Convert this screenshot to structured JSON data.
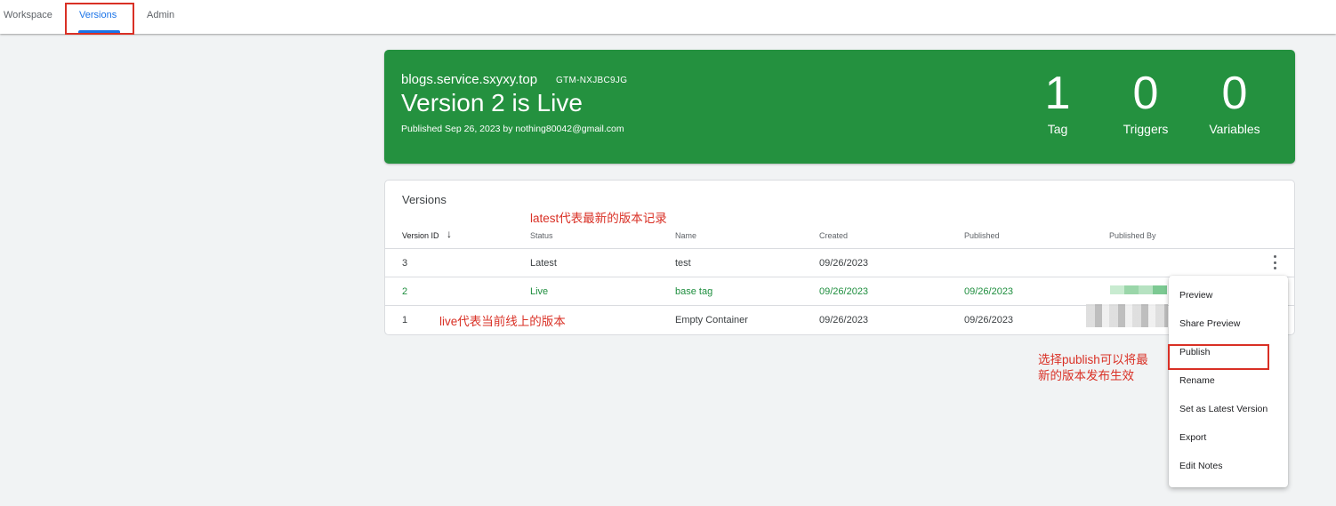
{
  "nav": {
    "tabs": [
      "Workspace",
      "Versions",
      "Admin"
    ],
    "active_tab": "Versions"
  },
  "hero": {
    "domain": "blogs.service.sxyxy.top",
    "container_id": "GTM-NXJBC9JG",
    "title": "Version 2 is Live",
    "published_line": "Published Sep 26, 2023 by nothing80042@gmail.com",
    "stats": [
      {
        "count": "1",
        "label": "Tag"
      },
      {
        "count": "0",
        "label": "Triggers"
      },
      {
        "count": "0",
        "label": "Variables"
      }
    ],
    "color": "#24913f"
  },
  "versions": {
    "title": "Versions",
    "columns": [
      "Version ID",
      "Status",
      "Name",
      "Created",
      "Published",
      "Published By"
    ],
    "rows": [
      {
        "id": "3",
        "status": "Latest",
        "name": "test",
        "created": "09/26/2023",
        "published": ""
      },
      {
        "id": "2",
        "status": "Live",
        "name": "base tag",
        "created": "09/26/2023",
        "published": "09/26/2023"
      },
      {
        "id": "1",
        "status": "",
        "name": "Empty Container",
        "created": "09/26/2023",
        "published": "09/26/2023"
      }
    ],
    "live_color": "#1e8e3e"
  },
  "menu": {
    "items": [
      "Preview",
      "Share Preview",
      "Publish",
      "Rename",
      "Set as Latest Version",
      "Export",
      "Edit Notes"
    ]
  },
  "annotations": {
    "latest": "latest代表最新的版本记录",
    "live": "live代表当前线上的版本",
    "publish_line1": "选择publish可以将最",
    "publish_line2": "新的版本发布生效",
    "color": "#d93025"
  }
}
